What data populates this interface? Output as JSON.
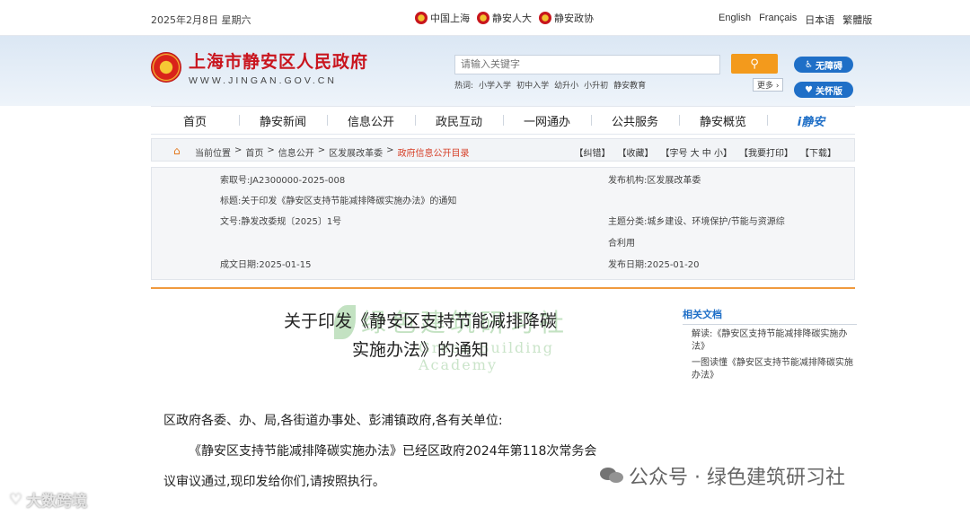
{
  "topbar": {
    "date": "2025年2月8日 星期六",
    "links": [
      "中国上海",
      "静安人大",
      "静安政协"
    ],
    "langs": [
      "English",
      "Français",
      "日本语",
      "繁體版"
    ]
  },
  "header": {
    "title": "上海市静安区人民政府",
    "domain": "WWW.JINGAN.GOV.CN",
    "search_placeholder": "请输入关键字",
    "hot_label": "热词:",
    "hot_words": [
      "小学入学",
      "初中入学",
      "幼升小",
      "小升初",
      "静安教育"
    ],
    "more": "更多",
    "accessible": "无障碍",
    "care": "关怀版"
  },
  "nav": [
    "首页",
    "静安新闻",
    "信息公开",
    "政民互动",
    "一网通办",
    "公共服务",
    "静安概览",
    "i静安"
  ],
  "breadcrumb": {
    "prefix": "当前位置",
    "items": [
      "首页",
      "信息公开",
      "区发展改革委"
    ],
    "current": "政府信息公开目录",
    "tools": [
      "【纠错】",
      "【收藏】",
      "【字号 大 中 小】",
      "【我要打印】",
      "【下载】"
    ]
  },
  "meta": {
    "index_no": "索取号:JA2300000-2025-008",
    "publisher": "发布机构:区发展改革委",
    "subject": "标题:关于印发《静安区支持节能减排降碳实施办法》的通知",
    "doc_no": "文号:静发改委规〔2025〕1号",
    "category_l1": "主题分类:城乡建设、环境保护/节能与资源综",
    "category_l2": "合利用",
    "created": "成文日期:2025-01-15",
    "published": "发布日期:2025-01-20"
  },
  "article": {
    "title_l1": "关于印发《静安区支持节能减排降碳",
    "title_l2": "实施办法》的通知",
    "salutation": "区政府各委、办、局,各街道办事处、彭浦镇政府,各有关单位:",
    "para1_l1": "《静安区支持节能减排降碳实施办法》已经区政府2024年第118次常务会",
    "para1_l2": "议审议通过,现印发给你们,请按照执行。"
  },
  "related": {
    "heading": "相关文档",
    "items": [
      "解读:《静安区支持节能减排降碳实施办法》",
      "一图读懂《静安区支持节能减排降碳实施办法》"
    ]
  },
  "overlays": {
    "watermark_cn": "绿色建筑研习社",
    "watermark_en": "Green Building Academy",
    "wechat": "公众号 · 绿色建筑研习社",
    "corner": "大数跨境"
  }
}
